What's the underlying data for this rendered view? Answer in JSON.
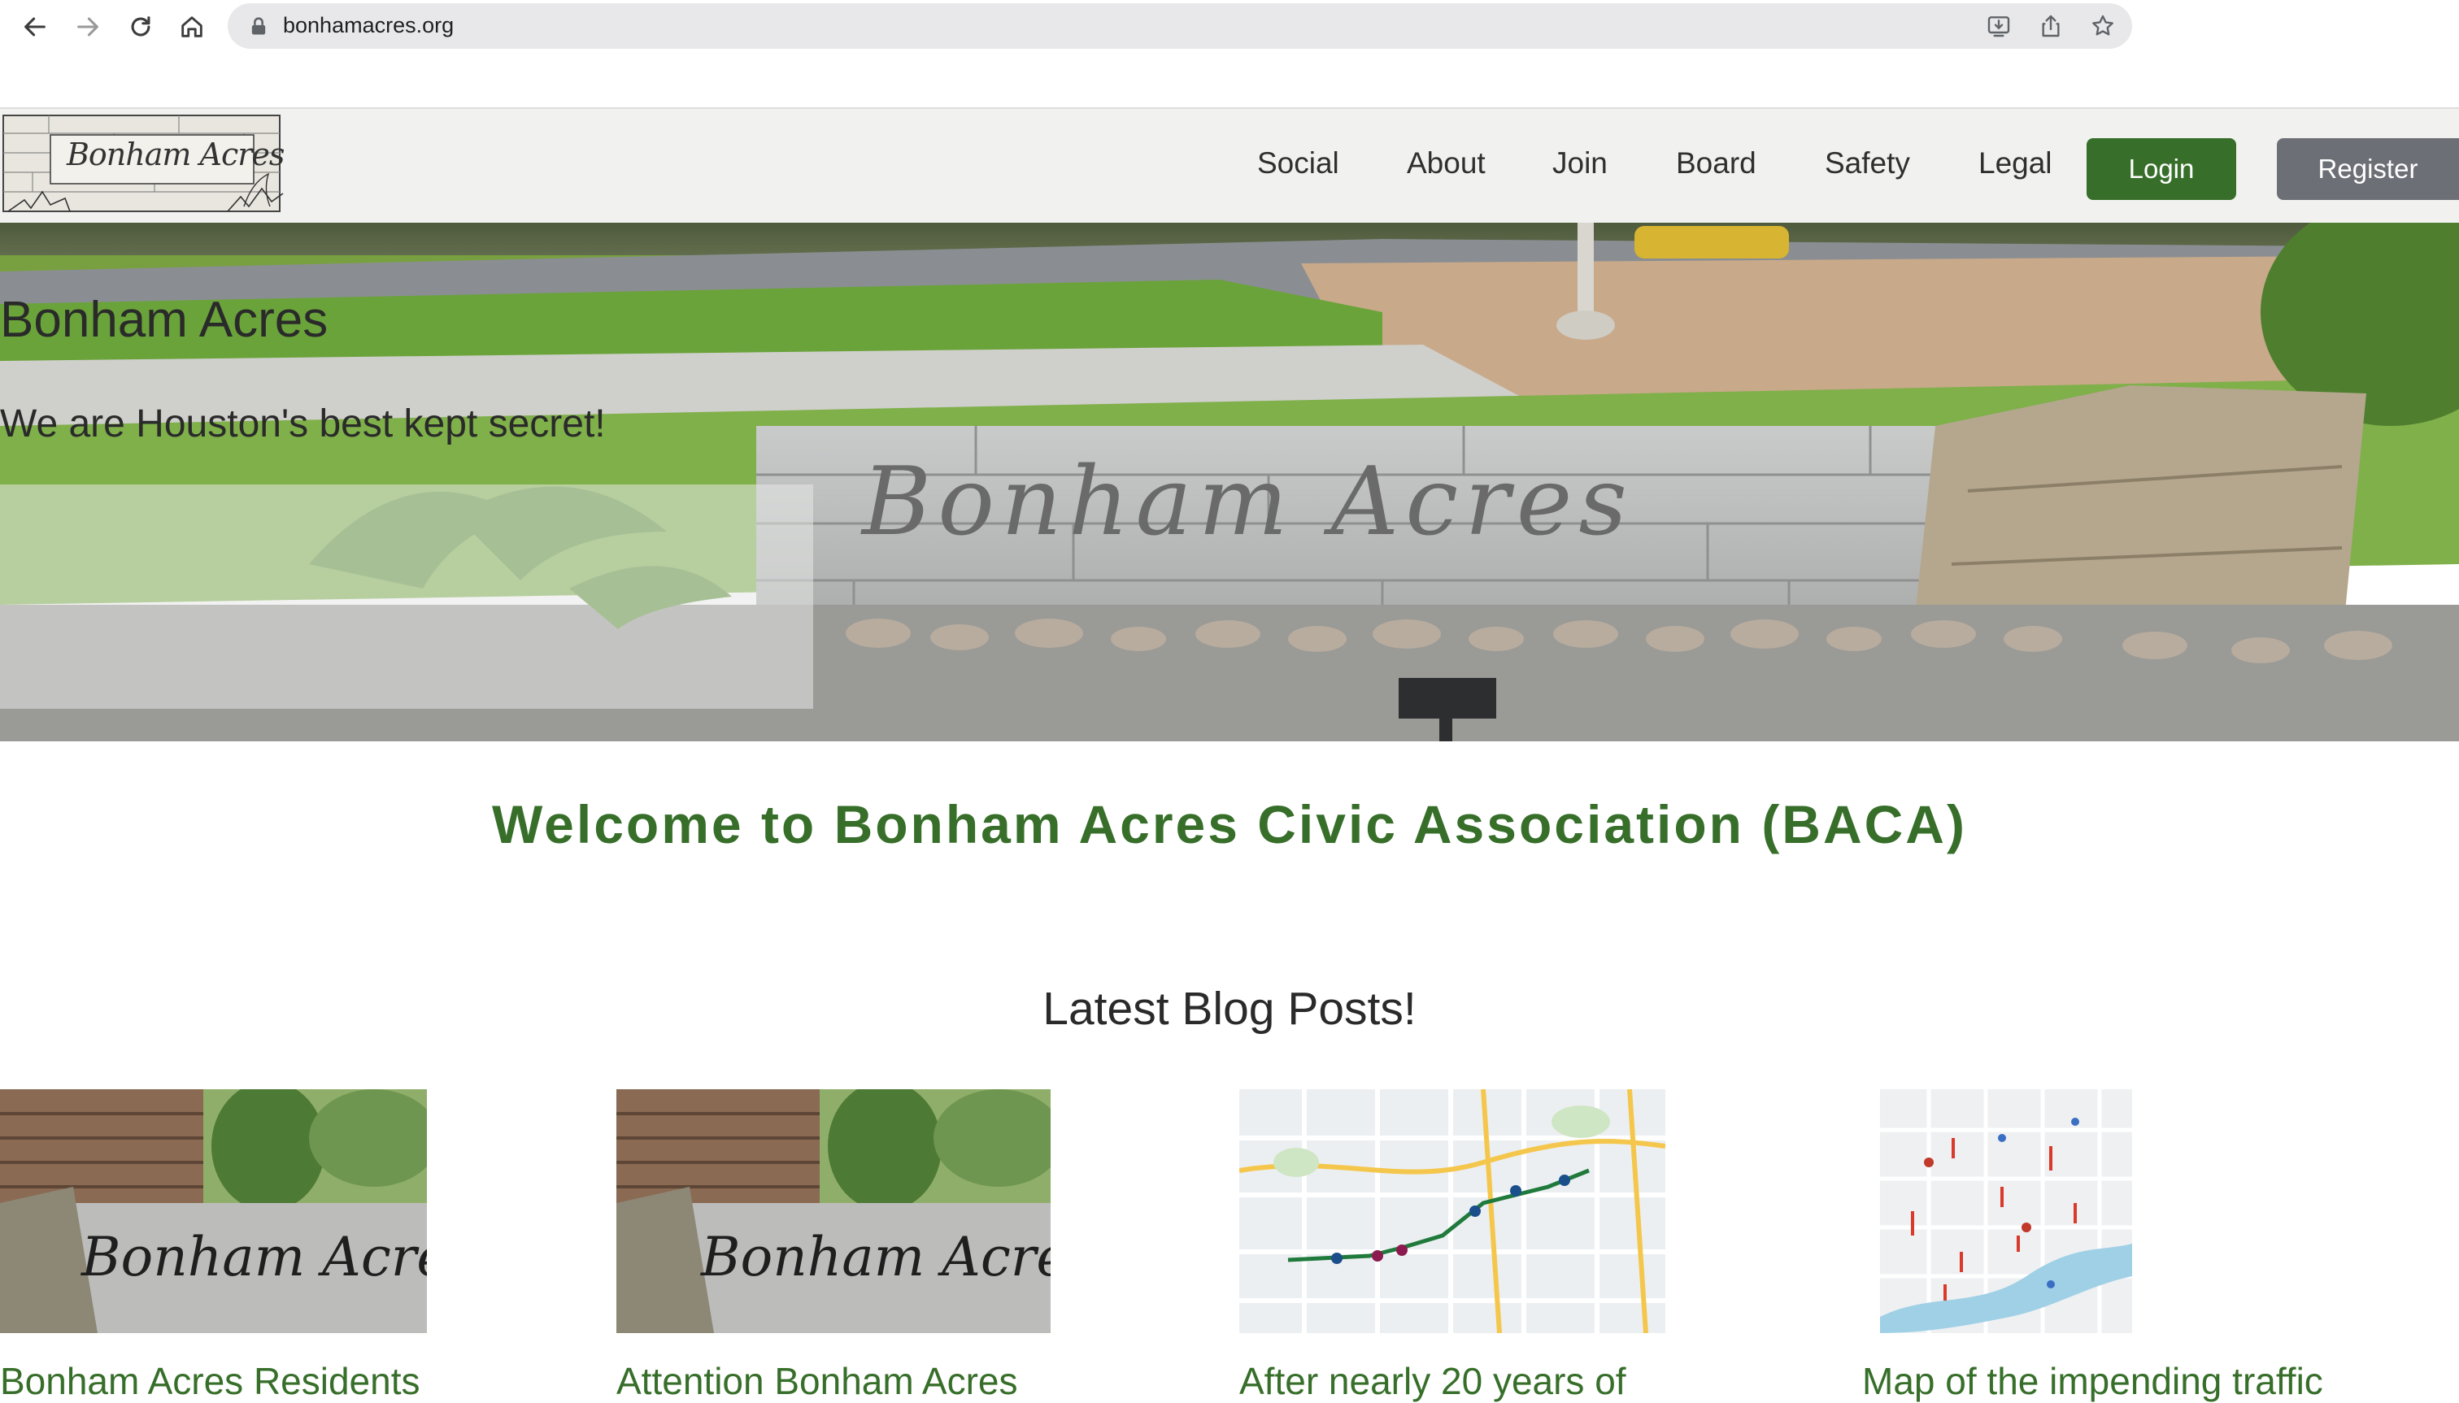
{
  "browser": {
    "url": "bonhamacres.org",
    "icons": {
      "back": "arrow-left-icon",
      "forward": "arrow-right-icon",
      "reload": "reload-icon",
      "home": "home-icon",
      "lock": "lock-icon",
      "install": "install-app-icon",
      "share": "share-icon",
      "bookmark": "star-icon"
    }
  },
  "header": {
    "logo_text": "Bonham Acres",
    "nav": [
      "Social",
      "About",
      "Join",
      "Board",
      "Safety",
      "Legal"
    ],
    "login_label": "Login",
    "register_label": "Register"
  },
  "hero": {
    "sign_text": "Bonham Acres",
    "title": "Bonham Acres",
    "tagline": "We are Houston's best kept secret!"
  },
  "welcome": {
    "heading": "Welcome to Bonham Acres Civic Association (BACA)"
  },
  "blog": {
    "heading": "Latest Blog Posts!",
    "posts": [
      {
        "image": "sign-photo",
        "image_text": "Bonham Acres",
        "title": "Bonham Acres Residents"
      },
      {
        "image": "sign-photo",
        "image_text": "Bonham Acres",
        "title": "Attention Bonham Acres"
      },
      {
        "image": "route-map",
        "image_text": "",
        "title": "After nearly 20 years of"
      },
      {
        "image": "traffic-map",
        "image_text": "",
        "title": "Map of the impending traffic"
      }
    ]
  },
  "colors": {
    "brand_green": "#376f2a",
    "register_gray": "#6d6f76",
    "header_bg": "#f1f2f0",
    "omnibox_bg": "#e8e8ea"
  }
}
